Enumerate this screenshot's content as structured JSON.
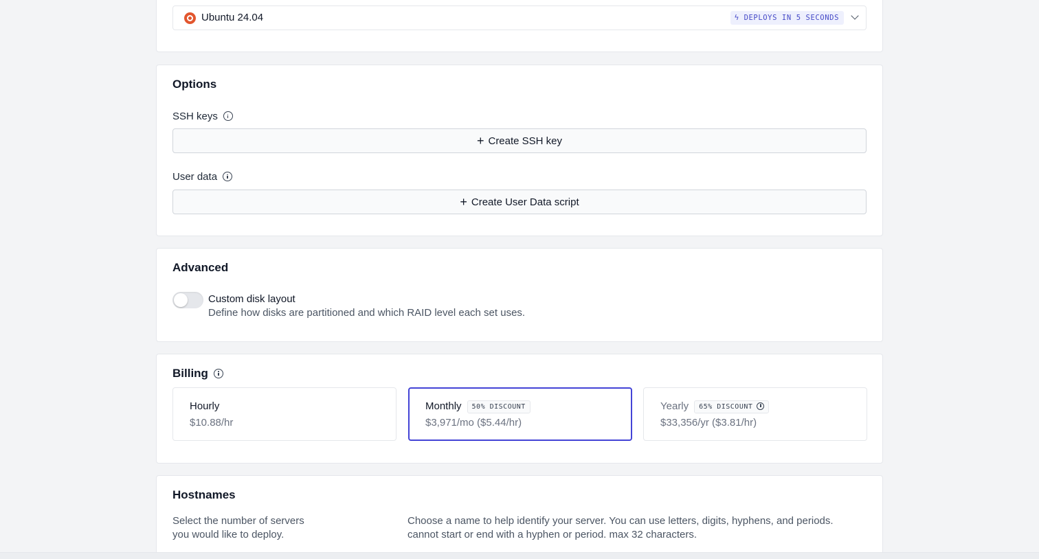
{
  "os": {
    "name": "Ubuntu 24.04",
    "deploy_badge": "DEPLOYS IN 5 SECONDS",
    "logo_color": "#e2562e"
  },
  "options": {
    "title": "Options",
    "ssh_label": "SSH keys",
    "ssh_button": "Create SSH key",
    "user_data_label": "User data",
    "user_data_button": "Create User Data script"
  },
  "advanced": {
    "title": "Advanced",
    "toggle_title": "Custom disk layout",
    "toggle_desc": "Define how disks are partitioned and which RAID level each set uses.",
    "toggle_on": false
  },
  "billing": {
    "title": "Billing",
    "accent": "#4343d6",
    "plans": [
      {
        "name": "Hourly",
        "price": "$10.88/hr",
        "discount": "",
        "selected": false
      },
      {
        "name": "Monthly",
        "price": "$3,971/mo ($5.44/hr)",
        "discount": "50% DISCOUNT",
        "selected": true
      },
      {
        "name": "Yearly",
        "price": "$33,356/yr ($3.81/hr)",
        "discount": "65% DISCOUNT",
        "selected": false
      }
    ]
  },
  "hostnames": {
    "title": "Hostnames",
    "count_help_line1": "Select the number of servers",
    "count_help_line2": "you would like to deploy.",
    "name_help_line1": "Choose a name to help identify your server. You can use letters, digits, hyphens, and periods.",
    "name_help_line2": "cannot start or end with a hyphen or period. max 32 characters."
  }
}
